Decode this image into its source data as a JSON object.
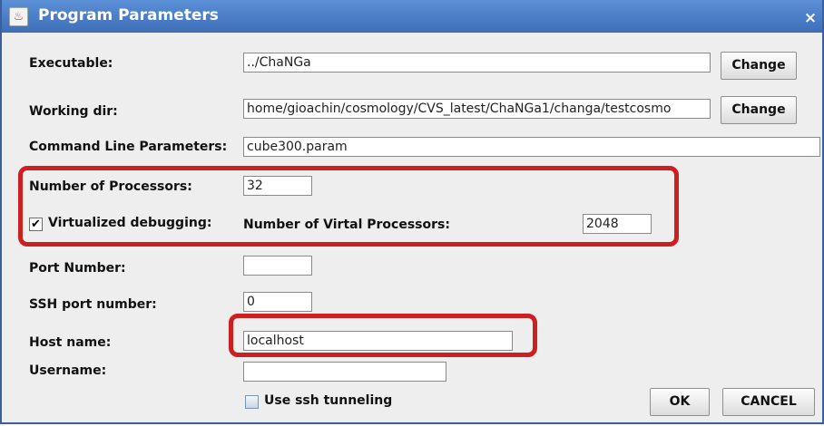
{
  "window": {
    "title": "Program Parameters",
    "close_glyph": "×"
  },
  "executable": {
    "label": "Executable:",
    "value": "../ChaNGa",
    "button": "Change"
  },
  "working_dir": {
    "label": "Working dir:",
    "value": "home/gioachin/cosmology/CVS_latest/ChaNGa1/changa/testcosmo",
    "button": "Change"
  },
  "command_line": {
    "label": "Command Line Parameters:",
    "value": "cube300.param"
  },
  "processors": {
    "label": "Number of Processors:",
    "value": "32"
  },
  "virtualized": {
    "checked": true,
    "check_glyph": "✔",
    "label": "Virtualized debugging:",
    "virtual_label": "Number of Virtal Processors:",
    "virtual_value": "2048"
  },
  "port": {
    "label": "Port Number:",
    "value": ""
  },
  "ssh_port": {
    "label": "SSH port number:",
    "value": "0"
  },
  "host": {
    "label": "Host name:",
    "value": "localhost"
  },
  "username": {
    "label": "Username:",
    "value": ""
  },
  "ssh_tunneling": {
    "checked": false,
    "label": "Use ssh tunneling"
  },
  "buttons": {
    "ok": "OK",
    "cancel": "CANCEL"
  },
  "colors": {
    "highlight": "#cc1f1f",
    "titlebar": "#4a7cc4"
  }
}
